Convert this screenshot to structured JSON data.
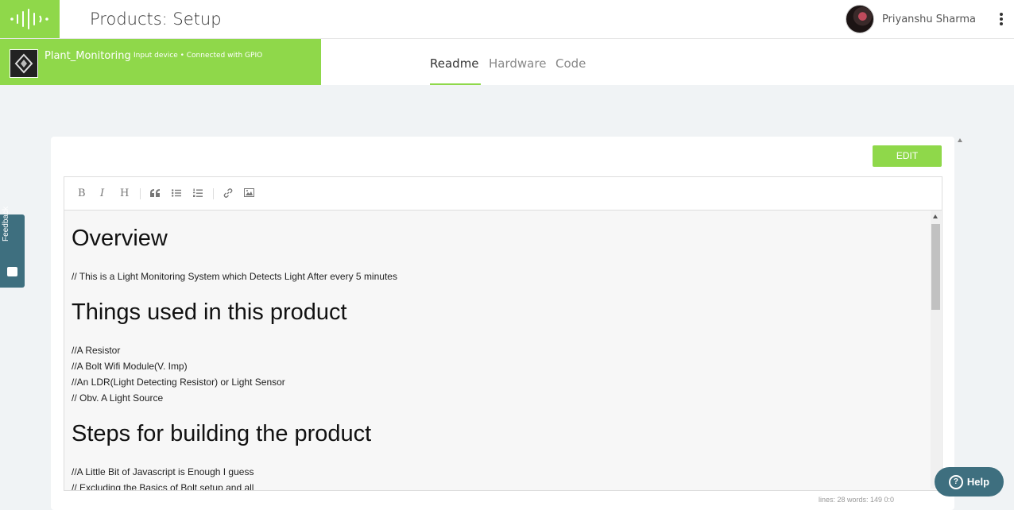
{
  "header": {
    "title": "Products: Setup",
    "user_name": "Priyanshu Sharma"
  },
  "device": {
    "name": "Plant_Monitoring",
    "info": "Input device • Connected with GPIO"
  },
  "tabs": [
    {
      "label": "Readme",
      "active": true
    },
    {
      "label": "Hardware",
      "active": false
    },
    {
      "label": "Code",
      "active": false
    }
  ],
  "editor": {
    "edit_label": "EDIT",
    "toolbar": {
      "bold": "B",
      "italic": "I",
      "heading": "H"
    },
    "content": {
      "h1_overview": "Overview",
      "overview_text": "// This is a Light Monitoring System which Detects Light After every 5 minutes",
      "h1_things": "Things used in this product",
      "things": [
        "//A Resistor",
        "//A Bolt Wifi Module(V. Imp)",
        "//An LDR(Light Detecting Resistor) or Light Sensor",
        "// Obv. A Light Source"
      ],
      "h1_steps": "Steps for building the product",
      "steps": [
        "//A Little Bit of Javascript is Enough I guess",
        "// Excluding the Basics of Bolt setup and all"
      ]
    },
    "status": "lines: 28    words: 149          0:0"
  },
  "feedback_label": "Feedback",
  "help_label": "Help",
  "colors": {
    "brand_green": "#8fd84a",
    "teal": "#3e6f7f"
  }
}
